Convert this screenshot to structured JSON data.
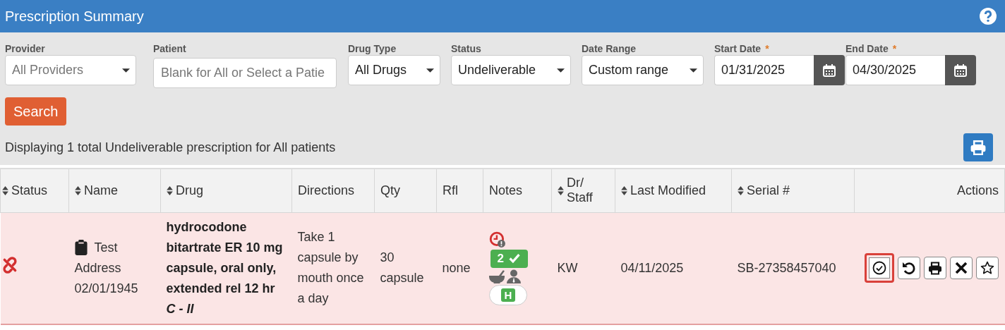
{
  "header": {
    "title": "Prescription Summary"
  },
  "filters": [
    {
      "kind": "select",
      "label": "Provider",
      "value": "All Providers",
      "muted": true
    },
    {
      "kind": "text",
      "label": "Patient",
      "placeholder": "Blank for All or Select a Patie"
    },
    {
      "kind": "select",
      "label": "Drug Type",
      "value": "All Drugs",
      "muted": false
    },
    {
      "kind": "select",
      "label": "Status",
      "value": "Undeliverable",
      "muted": false
    },
    {
      "kind": "select",
      "label": "Date Range",
      "value": "Custom range",
      "muted": false
    },
    {
      "kind": "date",
      "label": "Start Date",
      "required_mark": "*",
      "value": "01/31/2025"
    },
    {
      "kind": "date",
      "label": "End Date",
      "required_mark": "*",
      "value": "04/30/2025"
    }
  ],
  "search_button": "Search",
  "summary": "Displaying 1 total Undeliverable prescription for All patients",
  "table": {
    "columns": [
      {
        "label": "Status",
        "sortable": true
      },
      {
        "label": "Name",
        "sortable": true
      },
      {
        "label": "Drug",
        "sortable": true
      },
      {
        "label": "Directions",
        "sortable": false
      },
      {
        "label": "Qty",
        "sortable": false
      },
      {
        "label": "Rfl",
        "sortable": false
      },
      {
        "label": "Notes",
        "sortable": false
      },
      {
        "label": "Dr/ Staff",
        "sortable": true
      },
      {
        "label": "Last Modified",
        "sortable": true
      },
      {
        "label": "Serial #",
        "sortable": true
      },
      {
        "label": "Actions",
        "sortable": false
      }
    ],
    "rows": [
      {
        "unlinked": true,
        "name": "Test Address",
        "dob": "02/01/1945",
        "drug": "hydrocodone bitartrate ER 10 mg capsule, oral only, extended rel 12 hr *C - II*",
        "directions": "Take 1 capsule by mouth once a day",
        "qty": "30 capsule",
        "rfl": "none",
        "notes": {
          "check_count": "2",
          "badge_letter": "H"
        },
        "dr_staff": "KW",
        "last_modified": "04/11/2025",
        "serial": "SB-27358457040",
        "actions": [
          {
            "kind": "approve",
            "selected": true
          },
          {
            "kind": "undo",
            "selected": false
          },
          {
            "kind": "print",
            "selected": false
          },
          {
            "kind": "delete",
            "selected": false
          },
          {
            "kind": "favorite",
            "selected": false
          }
        ]
      }
    ]
  }
}
